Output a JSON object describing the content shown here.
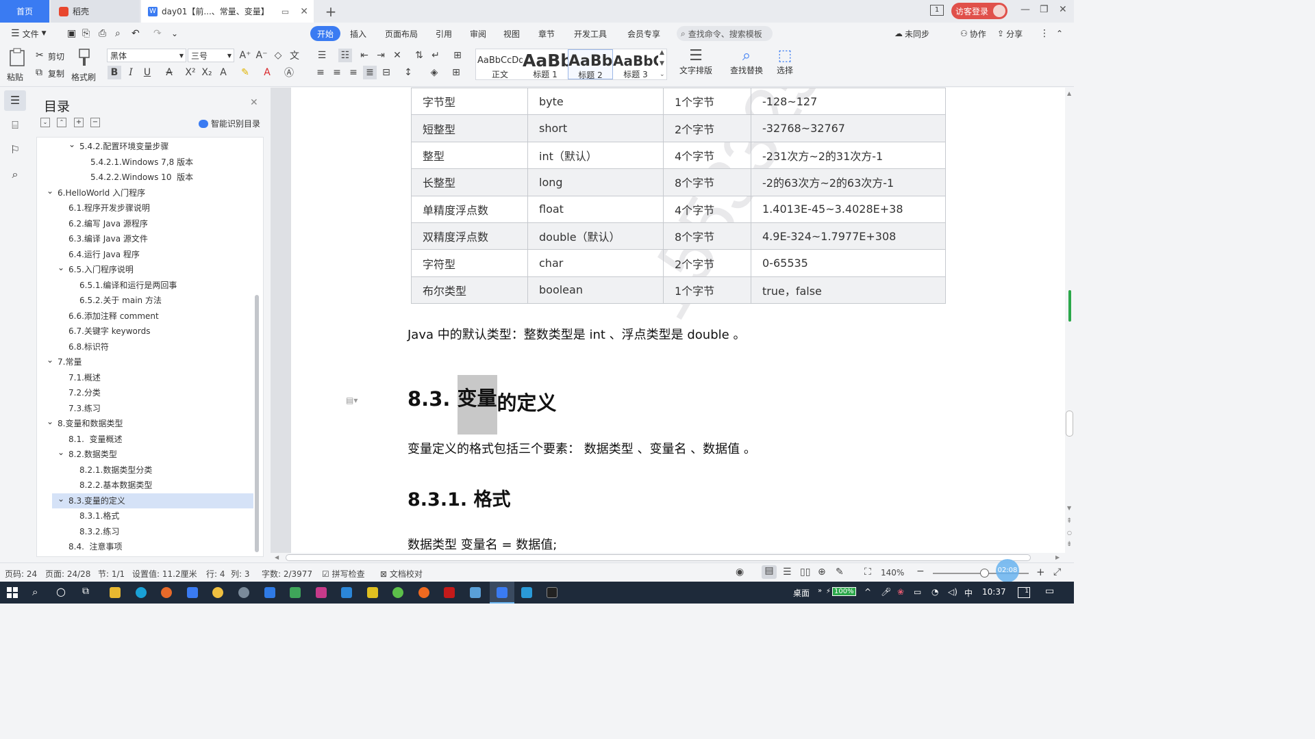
{
  "tabs": {
    "home": "首页",
    "daoke": "稻壳",
    "doc": "day01【前...、常量、变量】"
  },
  "titlebar": {
    "page_indicator": "1",
    "login": "访客登录"
  },
  "menu": {
    "file": "文件",
    "tabs": [
      "开始",
      "插入",
      "页面布局",
      "引用",
      "审阅",
      "视图",
      "章节",
      "开发工具",
      "会员专享"
    ],
    "search": "查找命令、搜索模板",
    "unsynced": "未同步",
    "collab": "协作",
    "share": "分享"
  },
  "ribbon": {
    "paste": "粘贴",
    "cut": "剪切",
    "copy": "复制",
    "format_painter": "格式刷",
    "font": "黑体",
    "size": "三号",
    "styles": [
      {
        "preview": "AaBbCcDd",
        "name": "正文"
      },
      {
        "preview": "AaBb",
        "name": "标题 1"
      },
      {
        "preview": "AaBb",
        "name": "标题 2"
      },
      {
        "preview": "AaBbC",
        "name": "标题 3"
      }
    ],
    "text_layout": "文字排版",
    "find_replace": "查找替换",
    "select": "选择"
  },
  "toc": {
    "title": "目录",
    "smart": "智能识别目录",
    "items": [
      {
        "label": "5.4.2.配置环境变量步骤",
        "level": 3,
        "arrow": true,
        "selected": false
      },
      {
        "label": "5.4.2.1.Windows 7,8 版本",
        "level": 4,
        "arrow": false,
        "selected": false
      },
      {
        "label": "5.4.2.2.Windows 10  版本",
        "level": 4,
        "arrow": false,
        "selected": false
      },
      {
        "label": "6.HelloWorld 入门程序",
        "level": 1,
        "arrow": true,
        "selected": false
      },
      {
        "label": "6.1.程序开发步骤说明",
        "level": 2,
        "arrow": false,
        "selected": false
      },
      {
        "label": "6.2.编写 Java 源程序",
        "level": 2,
        "arrow": false,
        "selected": false
      },
      {
        "label": "6.3.编译 Java 源文件",
        "level": 2,
        "arrow": false,
        "selected": false
      },
      {
        "label": "6.4.运行 Java 程序",
        "level": 2,
        "arrow": false,
        "selected": false
      },
      {
        "label": "6.5.入门程序说明",
        "level": 2,
        "arrow": true,
        "selected": false
      },
      {
        "label": "6.5.1.编译和运行是两回事",
        "level": 3,
        "arrow": false,
        "selected": false
      },
      {
        "label": "6.5.2.关于 main 方法",
        "level": 3,
        "arrow": false,
        "selected": false
      },
      {
        "label": "6.6.添加注释 comment",
        "level": 2,
        "arrow": false,
        "selected": false
      },
      {
        "label": "6.7.关键字 keywords",
        "level": 2,
        "arrow": false,
        "selected": false
      },
      {
        "label": "6.8.标识符",
        "level": 2,
        "arrow": false,
        "selected": false
      },
      {
        "label": "7.常量",
        "level": 1,
        "arrow": true,
        "selected": false
      },
      {
        "label": "7.1.概述",
        "level": 2,
        "arrow": false,
        "selected": false
      },
      {
        "label": "7.2.分类",
        "level": 2,
        "arrow": false,
        "selected": false
      },
      {
        "label": "7.3.练习",
        "level": 2,
        "arrow": false,
        "selected": false
      },
      {
        "label": "8.变量和数据类型",
        "level": 1,
        "arrow": true,
        "selected": false
      },
      {
        "label": "8.1.  变量概述",
        "level": 2,
        "arrow": false,
        "selected": false
      },
      {
        "label": "8.2.数据类型",
        "level": 2,
        "arrow": true,
        "selected": false
      },
      {
        "label": "8.2.1.数据类型分类",
        "level": 3,
        "arrow": false,
        "selected": false
      },
      {
        "label": "8.2.2.基本数据类型",
        "level": 3,
        "arrow": false,
        "selected": false
      },
      {
        "label": "8.3.变量的定义",
        "level": 2,
        "arrow": true,
        "selected": true
      },
      {
        "label": "8.3.1.格式",
        "level": 3,
        "arrow": false,
        "selected": false
      },
      {
        "label": "8.3.2.练习",
        "level": 3,
        "arrow": false,
        "selected": false
      },
      {
        "label": "8.4.  注意事项",
        "level": 2,
        "arrow": false,
        "selected": false
      }
    ]
  },
  "document": {
    "table": [
      [
        "字节型",
        "byte",
        "1个字节",
        "-128~127"
      ],
      [
        "短整型",
        "short",
        "2个字节",
        "-32768~32767"
      ],
      [
        "整型",
        "int（默认）",
        "4个字节",
        "-231次方~2的31次方-1"
      ],
      [
        "长整型",
        "long",
        "8个字节",
        "-2的63次方~2的63次方-1"
      ],
      [
        "单精度浮点数",
        "float",
        "4个字节",
        "1.4013E-45~3.4028E+38"
      ],
      [
        "双精度浮点数",
        "double（默认）",
        "8个字节",
        "4.9E-324~1.7977E+308"
      ],
      [
        "字符型",
        "char",
        "2个字节",
        "0-65535"
      ],
      [
        "布尔类型",
        "boolean",
        "1个字节",
        "true，false"
      ]
    ],
    "default_note": "Java 中的默认类型：整数类型是  int  、浮点类型是  double  。",
    "heading_num": "8.3. ",
    "heading_sel": "变量",
    "heading_rest": "的定义",
    "definition": "变量定义的格式包括三个要素：  数据类型  、变量名  、数据值  。",
    "subheading": "8.3.1. 格式",
    "format_line": "数据类型 变量名 = 数据值;",
    "watermark": "155332510"
  },
  "status": {
    "page_no": "页码: 24",
    "page": "页面: 24/28",
    "section": "节: 1/1",
    "setting": "设置值: 11.2厘米",
    "row": "行: 4",
    "col": "列: 3",
    "words": "字数: 2/3977",
    "spell": "拼写检查",
    "proof": "文档校对",
    "zoom": "140%",
    "timer": "02:08"
  },
  "taskbar": {
    "desktop": "桌面",
    "battery": "100%",
    "ime": "中",
    "time": "10:37",
    "notif": "1"
  }
}
